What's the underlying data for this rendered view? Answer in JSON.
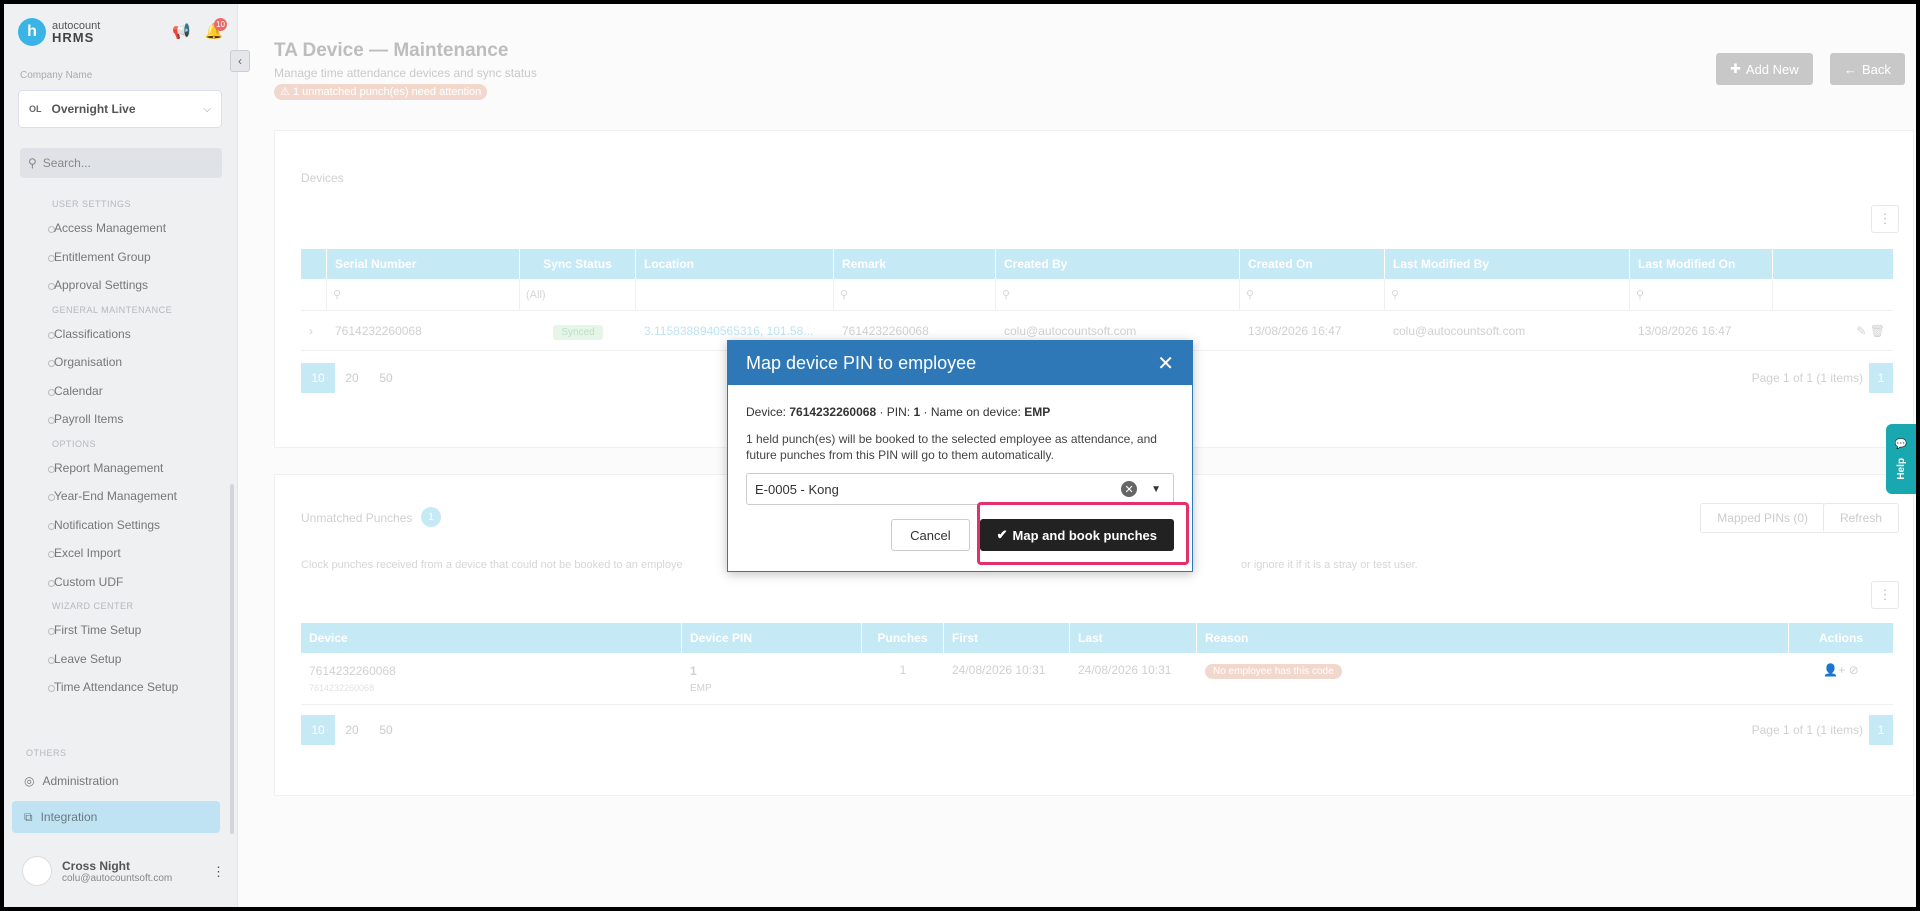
{
  "sidebar": {
    "logo_top": "autocount",
    "logo_main": "HRMS",
    "notif_count": "10",
    "company_label": "Company Name",
    "company_code": "OL",
    "company_name": "Overnight Live",
    "search_placeholder": "Search...",
    "sections": [
      {
        "title": "USER SETTINGS",
        "items": [
          "Access Management",
          "Entitlement Group",
          "Approval Settings"
        ]
      },
      {
        "title": "GENERAL MAINTENANCE",
        "items": [
          "Classifications",
          "Organisation",
          "Calendar",
          "Payroll Items"
        ]
      },
      {
        "title": "OPTIONS",
        "items": [
          "Report Management",
          "Year-End Management",
          "Notification Settings",
          "Excel Import",
          "Custom UDF"
        ]
      },
      {
        "title": "WIZARD CENTER",
        "items": [
          "First Time Setup",
          "Leave Setup",
          "Time Attendance Setup"
        ]
      }
    ],
    "others": "OTHERS",
    "administration": "Administration",
    "integration": "Integration",
    "user_name": "Cross Night",
    "user_email": "colu@autocountsoft.com"
  },
  "page": {
    "title": "TA Device — Maintenance",
    "subtitle": "Manage time attendance devices and sync status",
    "warning": "1 unmatched punch(es) need attention",
    "add_new": "Add New",
    "back": "Back"
  },
  "devices": {
    "title": "Devices",
    "columns": [
      "Serial Number",
      "Sync Status",
      "Location",
      "Remark",
      "Created By",
      "Created On",
      "Last Modified By",
      "Last Modified On"
    ],
    "filter_all": "(All)",
    "row": {
      "serial": "7614232260068",
      "sync": "Synced",
      "location": "3.1158388940565316, 101.58...",
      "remark": "7614232260068",
      "created_by": "colu@autocountsoft.com",
      "created_on": "13/08/2026 16:47",
      "modified_by": "colu@autocountsoft.com",
      "modified_on": "13/08/2026 16:47"
    },
    "page_sizes": [
      "10",
      "20",
      "50"
    ],
    "page_info": "Page 1 of 1 (1 items)",
    "page_num": "1"
  },
  "unmatched": {
    "title": "Unmatched Punches",
    "count": "1",
    "mapped_pins": "Mapped PINs (0)",
    "refresh": "Refresh",
    "description_left": "Clock punches received from a device that could not be booked to an employe",
    "description_right": "or ignore it if it is a stray or test user.",
    "columns": [
      "Device",
      "Device PIN",
      "Punches",
      "First",
      "Last",
      "Reason",
      "Actions"
    ],
    "row": {
      "device": "7614232260068",
      "device_sub": "7614232260068",
      "pin": "1",
      "pin_sub": "EMP",
      "punches": "1",
      "first": "24/08/2026 10:31",
      "last": "24/08/2026 10:31",
      "reason": "No employee has this code"
    },
    "page_sizes": [
      "10",
      "20",
      "50"
    ],
    "page_info": "Page 1 of 1 (1 items)",
    "page_num": "1"
  },
  "help": "Help",
  "modal": {
    "title": "Map device PIN to employee",
    "device_label": "Device:",
    "device_value": "7614232260068",
    "pin_label": "· PIN:",
    "pin_value": "1",
    "name_label": "· Name on device:",
    "name_value": "EMP",
    "info": "1 held punch(es) will be booked to the selected employee as attendance, and future punches from this PIN will go to them automatically.",
    "selected_employee": "E-0005 - Kong",
    "cancel": "Cancel",
    "confirm": "Map and book punches"
  }
}
